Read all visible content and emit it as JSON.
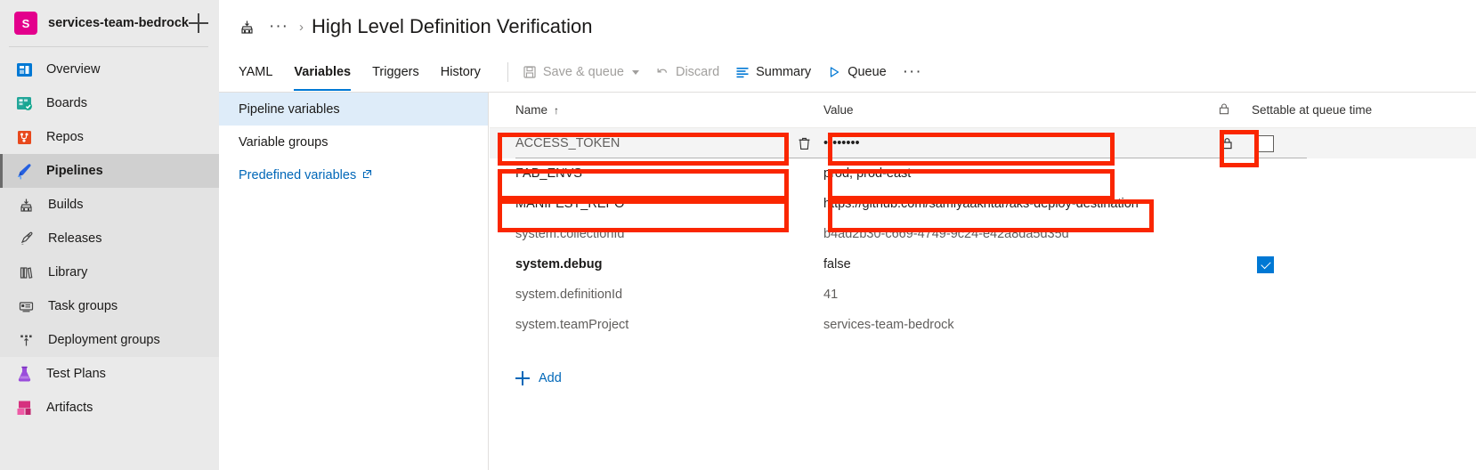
{
  "sidebar": {
    "org": {
      "initial": "S",
      "name": "services-team-bedrock",
      "add_label": "+"
    },
    "items": [
      {
        "label": "Overview",
        "icon": "overview-icon"
      },
      {
        "label": "Boards",
        "icon": "boards-icon"
      },
      {
        "label": "Repos",
        "icon": "repos-icon"
      },
      {
        "label": "Pipelines",
        "icon": "pipelines-icon"
      },
      {
        "label": "Builds",
        "icon": "builds-icon"
      },
      {
        "label": "Releases",
        "icon": "releases-icon"
      },
      {
        "label": "Library",
        "icon": "library-icon"
      },
      {
        "label": "Task groups",
        "icon": "task-groups-icon"
      },
      {
        "label": "Deployment groups",
        "icon": "deployment-groups-icon"
      },
      {
        "label": "Test Plans",
        "icon": "test-plans-icon"
      },
      {
        "label": "Artifacts",
        "icon": "artifacts-icon"
      }
    ]
  },
  "breadcrumb": {
    "pipeline_icon": "build-icon",
    "ellipsis": "···",
    "separator": "›",
    "title": "High Level Definition Verification"
  },
  "toolbar": {
    "tabs": [
      {
        "label": "YAML",
        "selected": false
      },
      {
        "label": "Variables",
        "selected": true
      },
      {
        "label": "Triggers",
        "selected": false
      },
      {
        "label": "History",
        "selected": false
      }
    ],
    "save_queue_label": "Save & queue",
    "discard_label": "Discard",
    "summary_label": "Summary",
    "queue_label": "Queue",
    "more_label": "···"
  },
  "variables_panel": {
    "pipeline_variables": "Pipeline variables",
    "variable_groups": "Variable groups",
    "predefined_variables": "Predefined variables",
    "external_link_icon": "external-link-icon"
  },
  "table": {
    "headers": {
      "name": "Name",
      "name_sort": "↑",
      "value": "Value",
      "lock": "lock-icon",
      "settable": "Settable at queue time"
    },
    "rows": [
      {
        "name": "ACCESS_TOKEN",
        "value": "••••••••",
        "name_muted": true,
        "editing": true,
        "has_delete": true,
        "locked": true,
        "settable": false,
        "show_checkbox": true
      },
      {
        "name": "FAB_ENVS",
        "value": "prod, prod-east",
        "name_muted": false,
        "editing": false,
        "has_delete": false,
        "locked": false,
        "settable": false,
        "show_checkbox": false
      },
      {
        "name": "MANIFEST_REPO",
        "value": "https://github.com/samiyaakhtar/aks-deploy-destination",
        "name_muted": false,
        "editing": false,
        "has_delete": false,
        "locked": false,
        "settable": false,
        "show_checkbox": false
      },
      {
        "name": "system.collectionId",
        "value": "b4ad2b30-c669-4749-9c24-e42a8da5d35d",
        "name_muted": true,
        "editing": false,
        "has_delete": false,
        "locked": false,
        "settable": false,
        "show_checkbox": false
      },
      {
        "name": "system.debug",
        "value": "false",
        "name_muted": false,
        "name_bold": true,
        "editing": false,
        "has_delete": false,
        "locked": false,
        "settable": true,
        "show_checkbox": true
      },
      {
        "name": "system.definitionId",
        "value": "41",
        "name_muted": true,
        "editing": false,
        "has_delete": false,
        "locked": false,
        "settable": false,
        "show_checkbox": false
      },
      {
        "name": "system.teamProject",
        "value": "services-team-bedrock",
        "name_muted": true,
        "editing": false,
        "has_delete": false,
        "locked": false,
        "settable": false,
        "show_checkbox": false
      }
    ],
    "add_label": "Add"
  },
  "annotations": {
    "highlight_color": "#fa2600",
    "boxes": [
      {
        "name": "access-token-name-highlight"
      },
      {
        "name": "access-token-value-highlight"
      },
      {
        "name": "access-token-lock-highlight"
      },
      {
        "name": "fab-envs-name-highlight"
      },
      {
        "name": "fab-envs-value-highlight"
      },
      {
        "name": "manifest-repo-name-highlight"
      },
      {
        "name": "manifest-repo-value-highlight"
      }
    ]
  }
}
